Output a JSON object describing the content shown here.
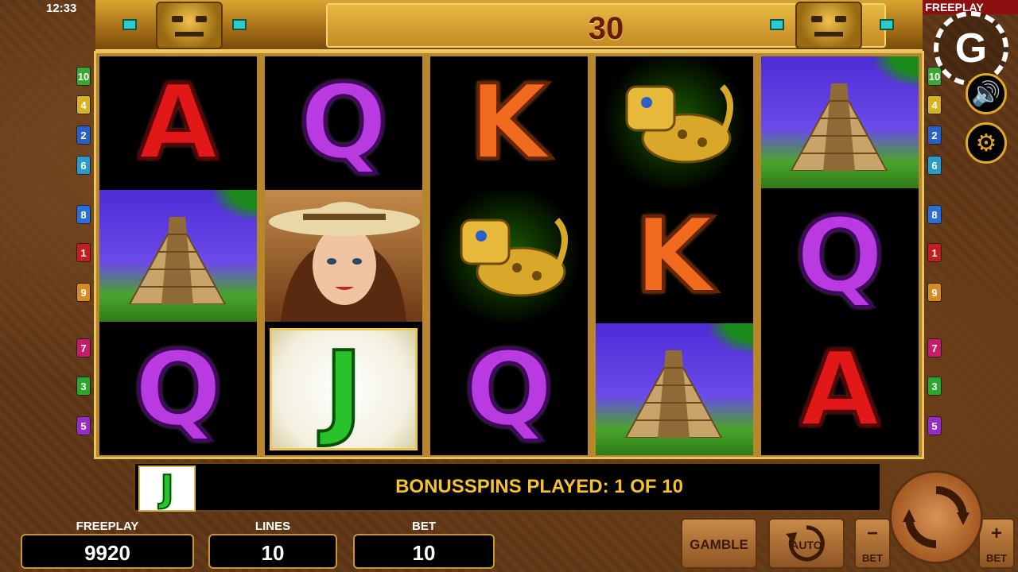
{
  "status": {
    "clock": "12:33",
    "mode": "FREEPLAY"
  },
  "banner": {
    "free_spins_count": "30"
  },
  "lines_left": [
    {
      "n": "10",
      "color": "#3aa82a"
    },
    {
      "n": "4",
      "color": "#d9b21c"
    },
    {
      "n": "2",
      "color": "#2a5fc8"
    },
    {
      "n": "6",
      "color": "#2a9ac8"
    },
    {
      "n": "8",
      "color": "#2a6fd8"
    },
    {
      "n": "1",
      "color": "#c81c1c"
    },
    {
      "n": "9",
      "color": "#d98a1c"
    },
    {
      "n": "7",
      "color": "#c81c6a"
    },
    {
      "n": "3",
      "color": "#2aa82a"
    },
    {
      "n": "5",
      "color": "#9a2ac8"
    }
  ],
  "lines_right": [
    {
      "n": "10",
      "color": "#3aa82a"
    },
    {
      "n": "4",
      "color": "#d9b21c"
    },
    {
      "n": "2",
      "color": "#2a5fc8"
    },
    {
      "n": "6",
      "color": "#2a9ac8"
    },
    {
      "n": "8",
      "color": "#2a6fd8"
    },
    {
      "n": "1",
      "color": "#c81c1c"
    },
    {
      "n": "9",
      "color": "#d98a1c"
    },
    {
      "n": "7",
      "color": "#c81c6a"
    },
    {
      "n": "3",
      "color": "#2aa82a"
    },
    {
      "n": "5",
      "color": "#9a2ac8"
    }
  ],
  "reels": [
    [
      {
        "type": "letter",
        "value": "A"
      },
      {
        "type": "pyramid"
      },
      {
        "type": "letter",
        "value": "Q"
      }
    ],
    [
      {
        "type": "letter",
        "value": "Q"
      },
      {
        "type": "woman"
      },
      {
        "type": "letter",
        "value": "J",
        "highlight": true
      }
    ],
    [
      {
        "type": "letter",
        "value": "K"
      },
      {
        "type": "jaguar"
      },
      {
        "type": "letter",
        "value": "Q"
      }
    ],
    [
      {
        "type": "jaguar"
      },
      {
        "type": "letter",
        "value": "K"
      },
      {
        "type": "pyramid"
      }
    ],
    [
      {
        "type": "pyramid"
      },
      {
        "type": "letter",
        "value": "Q"
      },
      {
        "type": "letter",
        "value": "A"
      }
    ]
  ],
  "info": {
    "symbol": "J",
    "message": "BONUSSPINS PLAYED: 1 OF 10"
  },
  "stats": {
    "freeplay_label": "FREEPLAY",
    "freeplay_value": "9920",
    "lines_label": "LINES",
    "lines_value": "10",
    "bet_label": "BET",
    "bet_value": "10"
  },
  "controls": {
    "gamble": "GAMBLE",
    "auto": "AUTO",
    "bet_minus": "BET",
    "bet_plus": "BET",
    "minus_sign": "−",
    "plus_sign": "+"
  },
  "side": {
    "logo": "G",
    "sound_icon": "🔊",
    "settings_icon": "⚙"
  }
}
